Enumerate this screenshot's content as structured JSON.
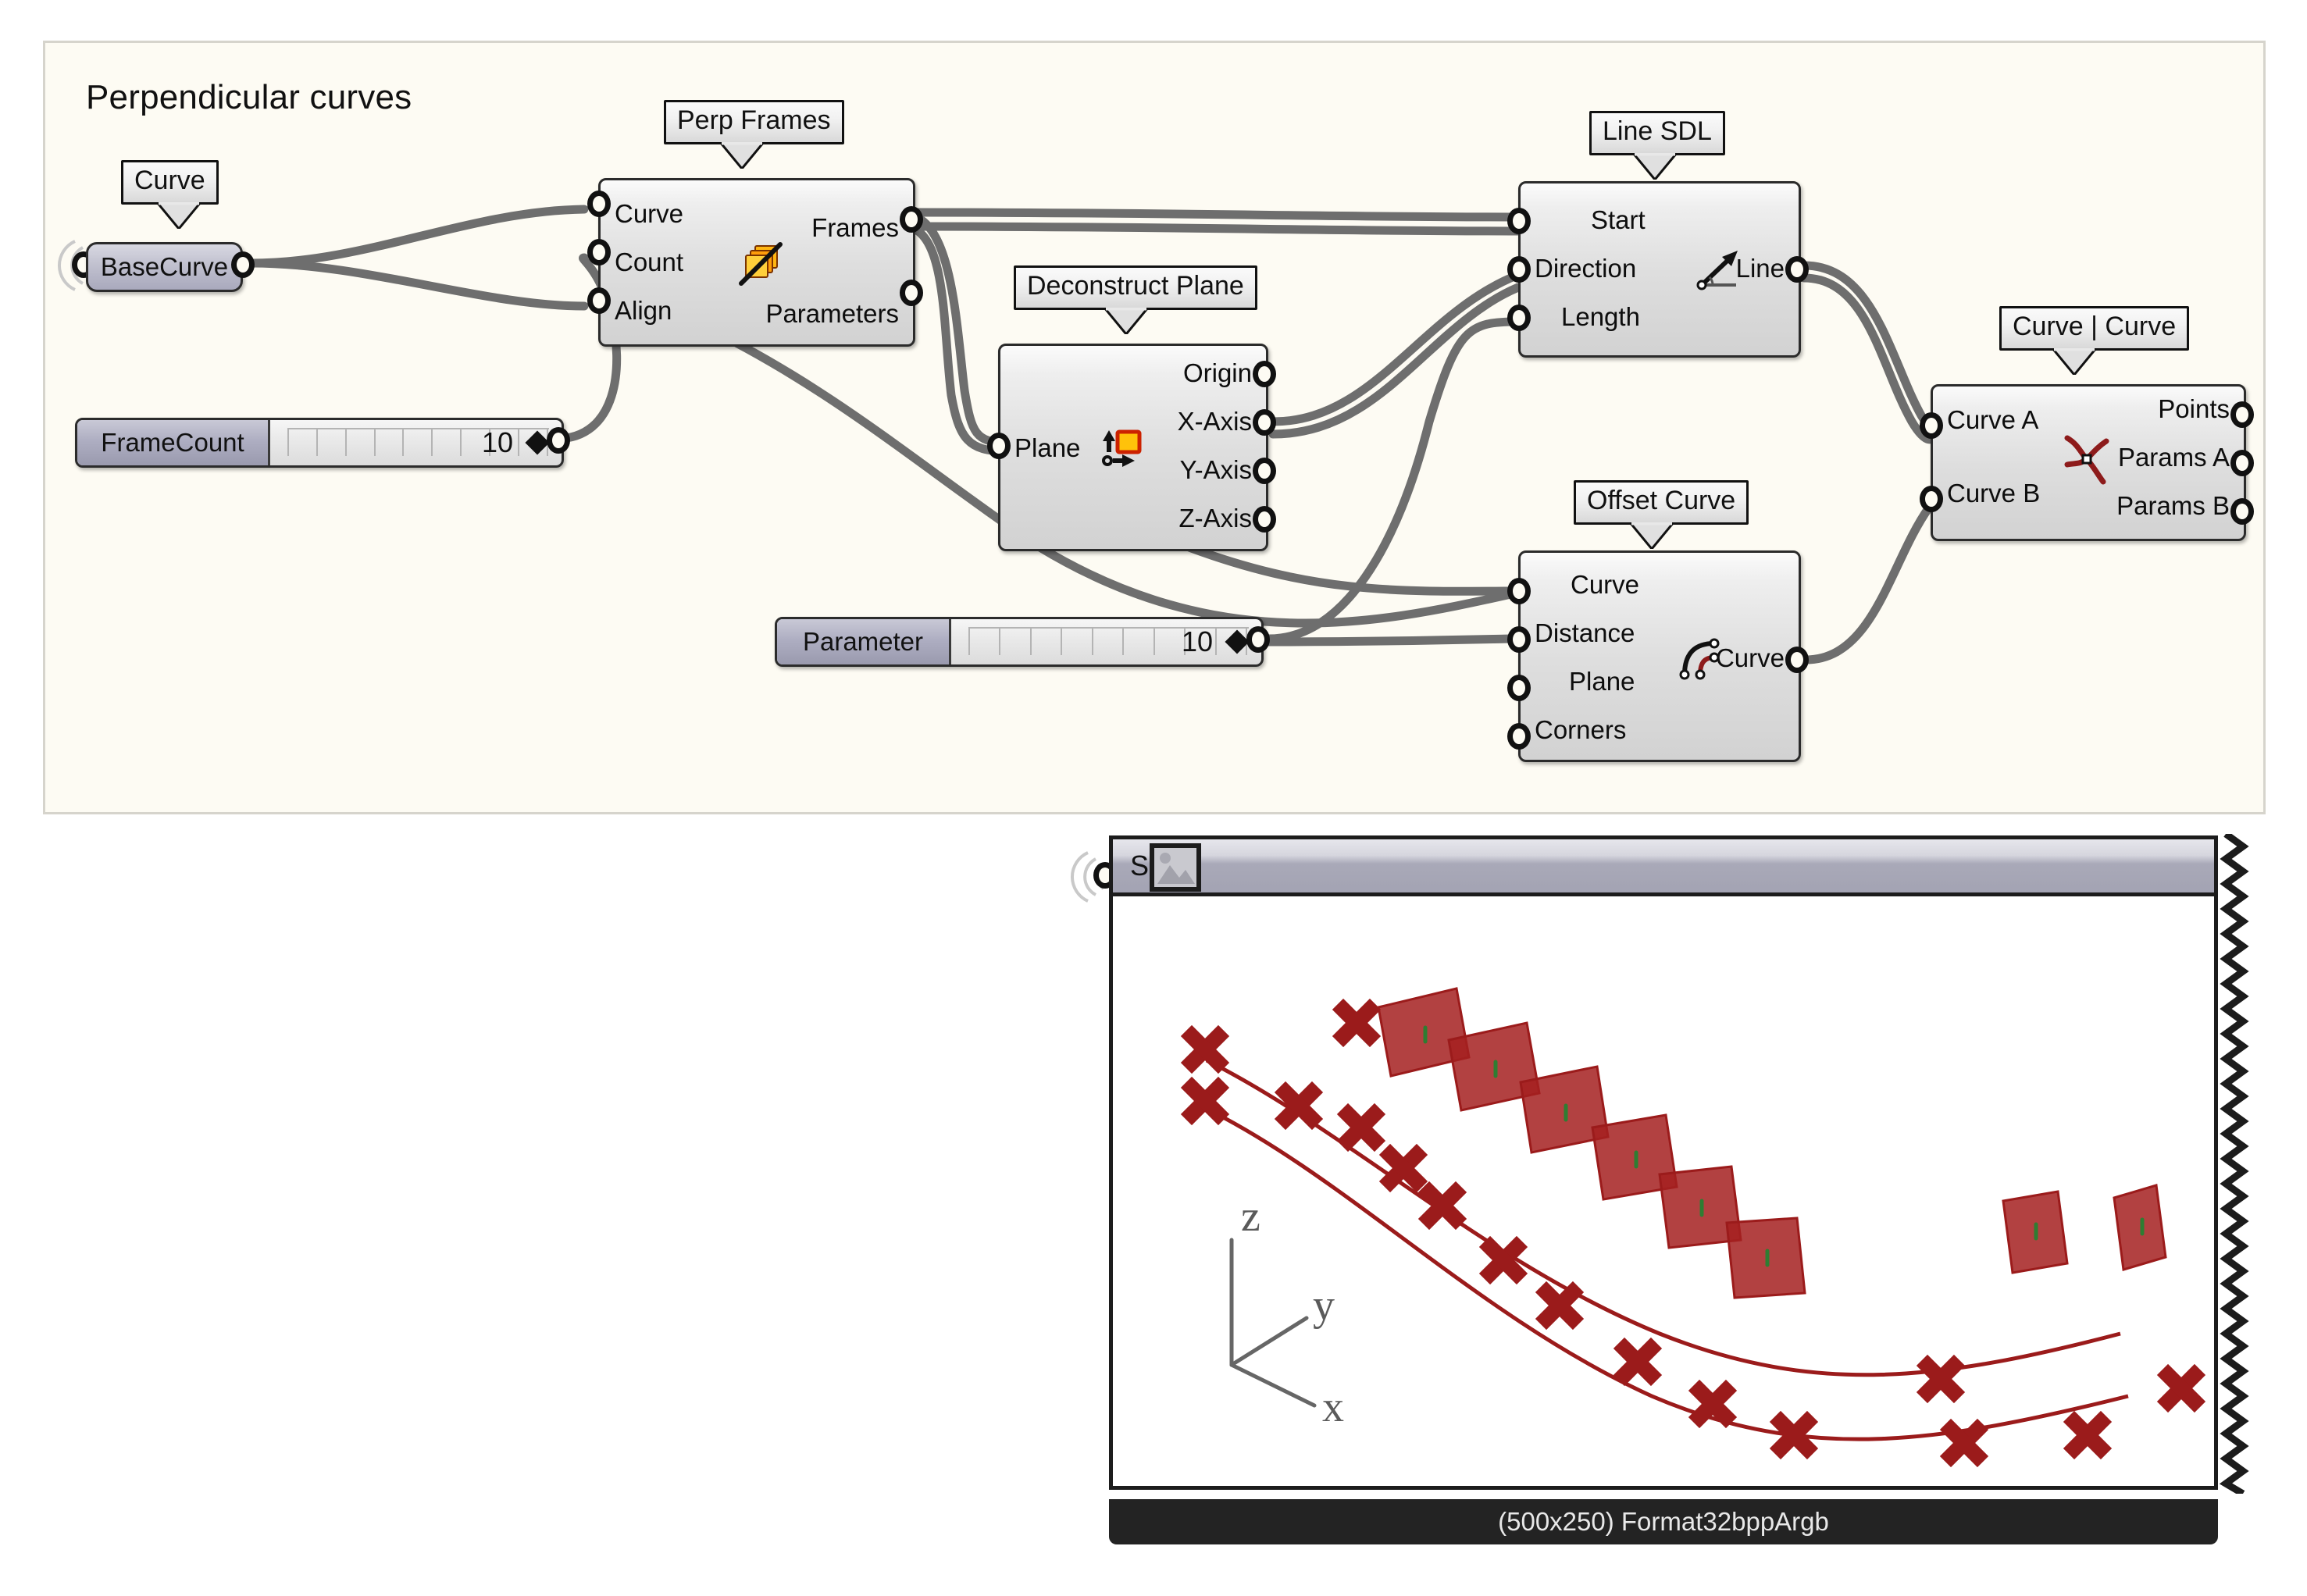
{
  "app": {
    "kind": "grasshopper-node-graph",
    "canvas_bg": "#ffffff"
  },
  "group": {
    "title": "Perpendicular curves",
    "bg": "#fdfbf3",
    "border": "#d6d4cc"
  },
  "balloons": {
    "curve": "Curve",
    "perp_frames": "Perp Frames",
    "deconstruct_plane": "Deconstruct Plane",
    "line_sdl": "Line SDL",
    "offset_curve": "Offset Curve",
    "curve_curve": "Curve | Curve"
  },
  "params": {
    "base_curve": {
      "label": "BaseCurve"
    },
    "frame_count": {
      "label": "FrameCount",
      "value": "10"
    },
    "parameter": {
      "label": "Parameter",
      "value": "10"
    }
  },
  "nodes": {
    "perp_frames": {
      "name": "Perp Frames",
      "icon": "perp-frames-icon",
      "inputs": [
        "Curve",
        "Count",
        "Align"
      ],
      "outputs": [
        "Frames",
        "Parameters"
      ]
    },
    "deconstruct_plane": {
      "name": "Deconstruct Plane",
      "icon": "deconstruct-plane-icon",
      "inputs": [
        "Plane"
      ],
      "outputs": [
        "Origin",
        "X-Axis",
        "Y-Axis",
        "Z-Axis"
      ]
    },
    "line_sdl": {
      "name": "Line SDL",
      "icon": "line-sdl-icon",
      "inputs": [
        "Start",
        "Direction",
        "Length"
      ],
      "outputs": [
        "Line"
      ]
    },
    "offset_curve": {
      "name": "Offset Curve",
      "icon": "offset-curve-icon",
      "inputs": [
        "Curve",
        "Distance",
        "Plane",
        "Corners"
      ],
      "outputs": [
        "Curve"
      ]
    },
    "curve_curve": {
      "name": "Curve | Curve",
      "icon": "curve-curve-icon",
      "inputs": [
        "Curve A",
        "Curve B"
      ],
      "outputs": [
        "Points",
        "Params A",
        "Params B"
      ]
    }
  },
  "image_panel": {
    "nickname": "S",
    "thumb_icon": "picture-icon",
    "status": "(500x250) Format32bppArgb",
    "viewport": {
      "axes": [
        "z",
        "y",
        "x"
      ],
      "geometry_color": "#9b1b1b",
      "accent_color": "#2e7d32"
    }
  },
  "colors": {
    "wire": "#6e6e6e",
    "node_border": "#2b2b2b",
    "slider_name_bg": "#aeaec2",
    "panel_header_bg": "#a9a9b8",
    "status_bg": "#232323",
    "geometry_red": "#9b1b1b"
  }
}
